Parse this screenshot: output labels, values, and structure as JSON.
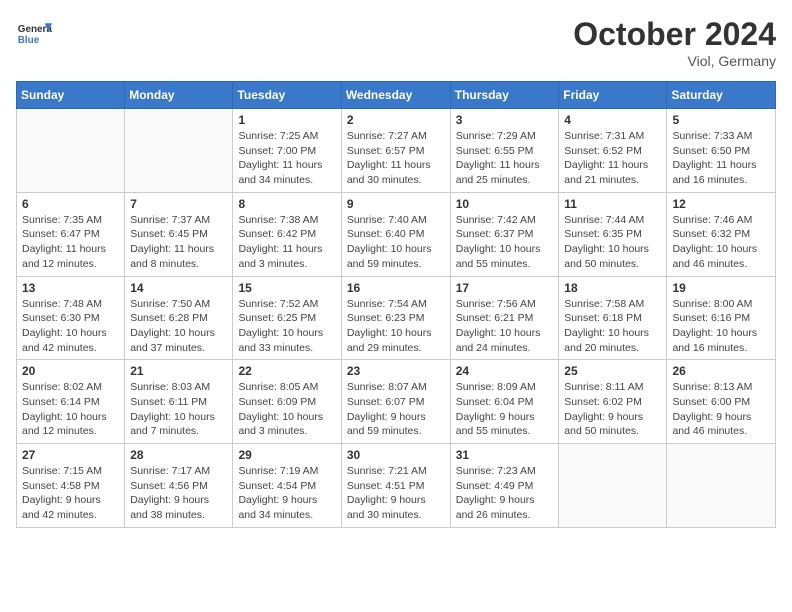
{
  "header": {
    "logo_line1": "General",
    "logo_line2": "Blue",
    "month_title": "October 2024",
    "location": "Viol, Germany"
  },
  "weekdays": [
    "Sunday",
    "Monday",
    "Tuesday",
    "Wednesday",
    "Thursday",
    "Friday",
    "Saturday"
  ],
  "weeks": [
    [
      {
        "day": "",
        "sunrise": "",
        "sunset": "",
        "daylight": ""
      },
      {
        "day": "",
        "sunrise": "",
        "sunset": "",
        "daylight": ""
      },
      {
        "day": "1",
        "sunrise": "Sunrise: 7:25 AM",
        "sunset": "Sunset: 7:00 PM",
        "daylight": "Daylight: 11 hours and 34 minutes."
      },
      {
        "day": "2",
        "sunrise": "Sunrise: 7:27 AM",
        "sunset": "Sunset: 6:57 PM",
        "daylight": "Daylight: 11 hours and 30 minutes."
      },
      {
        "day": "3",
        "sunrise": "Sunrise: 7:29 AM",
        "sunset": "Sunset: 6:55 PM",
        "daylight": "Daylight: 11 hours and 25 minutes."
      },
      {
        "day": "4",
        "sunrise": "Sunrise: 7:31 AM",
        "sunset": "Sunset: 6:52 PM",
        "daylight": "Daylight: 11 hours and 21 minutes."
      },
      {
        "day": "5",
        "sunrise": "Sunrise: 7:33 AM",
        "sunset": "Sunset: 6:50 PM",
        "daylight": "Daylight: 11 hours and 16 minutes."
      }
    ],
    [
      {
        "day": "6",
        "sunrise": "Sunrise: 7:35 AM",
        "sunset": "Sunset: 6:47 PM",
        "daylight": "Daylight: 11 hours and 12 minutes."
      },
      {
        "day": "7",
        "sunrise": "Sunrise: 7:37 AM",
        "sunset": "Sunset: 6:45 PM",
        "daylight": "Daylight: 11 hours and 8 minutes."
      },
      {
        "day": "8",
        "sunrise": "Sunrise: 7:38 AM",
        "sunset": "Sunset: 6:42 PM",
        "daylight": "Daylight: 11 hours and 3 minutes."
      },
      {
        "day": "9",
        "sunrise": "Sunrise: 7:40 AM",
        "sunset": "Sunset: 6:40 PM",
        "daylight": "Daylight: 10 hours and 59 minutes."
      },
      {
        "day": "10",
        "sunrise": "Sunrise: 7:42 AM",
        "sunset": "Sunset: 6:37 PM",
        "daylight": "Daylight: 10 hours and 55 minutes."
      },
      {
        "day": "11",
        "sunrise": "Sunrise: 7:44 AM",
        "sunset": "Sunset: 6:35 PM",
        "daylight": "Daylight: 10 hours and 50 minutes."
      },
      {
        "day": "12",
        "sunrise": "Sunrise: 7:46 AM",
        "sunset": "Sunset: 6:32 PM",
        "daylight": "Daylight: 10 hours and 46 minutes."
      }
    ],
    [
      {
        "day": "13",
        "sunrise": "Sunrise: 7:48 AM",
        "sunset": "Sunset: 6:30 PM",
        "daylight": "Daylight: 10 hours and 42 minutes."
      },
      {
        "day": "14",
        "sunrise": "Sunrise: 7:50 AM",
        "sunset": "Sunset: 6:28 PM",
        "daylight": "Daylight: 10 hours and 37 minutes."
      },
      {
        "day": "15",
        "sunrise": "Sunrise: 7:52 AM",
        "sunset": "Sunset: 6:25 PM",
        "daylight": "Daylight: 10 hours and 33 minutes."
      },
      {
        "day": "16",
        "sunrise": "Sunrise: 7:54 AM",
        "sunset": "Sunset: 6:23 PM",
        "daylight": "Daylight: 10 hours and 29 minutes."
      },
      {
        "day": "17",
        "sunrise": "Sunrise: 7:56 AM",
        "sunset": "Sunset: 6:21 PM",
        "daylight": "Daylight: 10 hours and 24 minutes."
      },
      {
        "day": "18",
        "sunrise": "Sunrise: 7:58 AM",
        "sunset": "Sunset: 6:18 PM",
        "daylight": "Daylight: 10 hours and 20 minutes."
      },
      {
        "day": "19",
        "sunrise": "Sunrise: 8:00 AM",
        "sunset": "Sunset: 6:16 PM",
        "daylight": "Daylight: 10 hours and 16 minutes."
      }
    ],
    [
      {
        "day": "20",
        "sunrise": "Sunrise: 8:02 AM",
        "sunset": "Sunset: 6:14 PM",
        "daylight": "Daylight: 10 hours and 12 minutes."
      },
      {
        "day": "21",
        "sunrise": "Sunrise: 8:03 AM",
        "sunset": "Sunset: 6:11 PM",
        "daylight": "Daylight: 10 hours and 7 minutes."
      },
      {
        "day": "22",
        "sunrise": "Sunrise: 8:05 AM",
        "sunset": "Sunset: 6:09 PM",
        "daylight": "Daylight: 10 hours and 3 minutes."
      },
      {
        "day": "23",
        "sunrise": "Sunrise: 8:07 AM",
        "sunset": "Sunset: 6:07 PM",
        "daylight": "Daylight: 9 hours and 59 minutes."
      },
      {
        "day": "24",
        "sunrise": "Sunrise: 8:09 AM",
        "sunset": "Sunset: 6:04 PM",
        "daylight": "Daylight: 9 hours and 55 minutes."
      },
      {
        "day": "25",
        "sunrise": "Sunrise: 8:11 AM",
        "sunset": "Sunset: 6:02 PM",
        "daylight": "Daylight: 9 hours and 50 minutes."
      },
      {
        "day": "26",
        "sunrise": "Sunrise: 8:13 AM",
        "sunset": "Sunset: 6:00 PM",
        "daylight": "Daylight: 9 hours and 46 minutes."
      }
    ],
    [
      {
        "day": "27",
        "sunrise": "Sunrise: 7:15 AM",
        "sunset": "Sunset: 4:58 PM",
        "daylight": "Daylight: 9 hours and 42 minutes."
      },
      {
        "day": "28",
        "sunrise": "Sunrise: 7:17 AM",
        "sunset": "Sunset: 4:56 PM",
        "daylight": "Daylight: 9 hours and 38 minutes."
      },
      {
        "day": "29",
        "sunrise": "Sunrise: 7:19 AM",
        "sunset": "Sunset: 4:54 PM",
        "daylight": "Daylight: 9 hours and 34 minutes."
      },
      {
        "day": "30",
        "sunrise": "Sunrise: 7:21 AM",
        "sunset": "Sunset: 4:51 PM",
        "daylight": "Daylight: 9 hours and 30 minutes."
      },
      {
        "day": "31",
        "sunrise": "Sunrise: 7:23 AM",
        "sunset": "Sunset: 4:49 PM",
        "daylight": "Daylight: 9 hours and 26 minutes."
      },
      {
        "day": "",
        "sunrise": "",
        "sunset": "",
        "daylight": ""
      },
      {
        "day": "",
        "sunrise": "",
        "sunset": "",
        "daylight": ""
      }
    ]
  ]
}
